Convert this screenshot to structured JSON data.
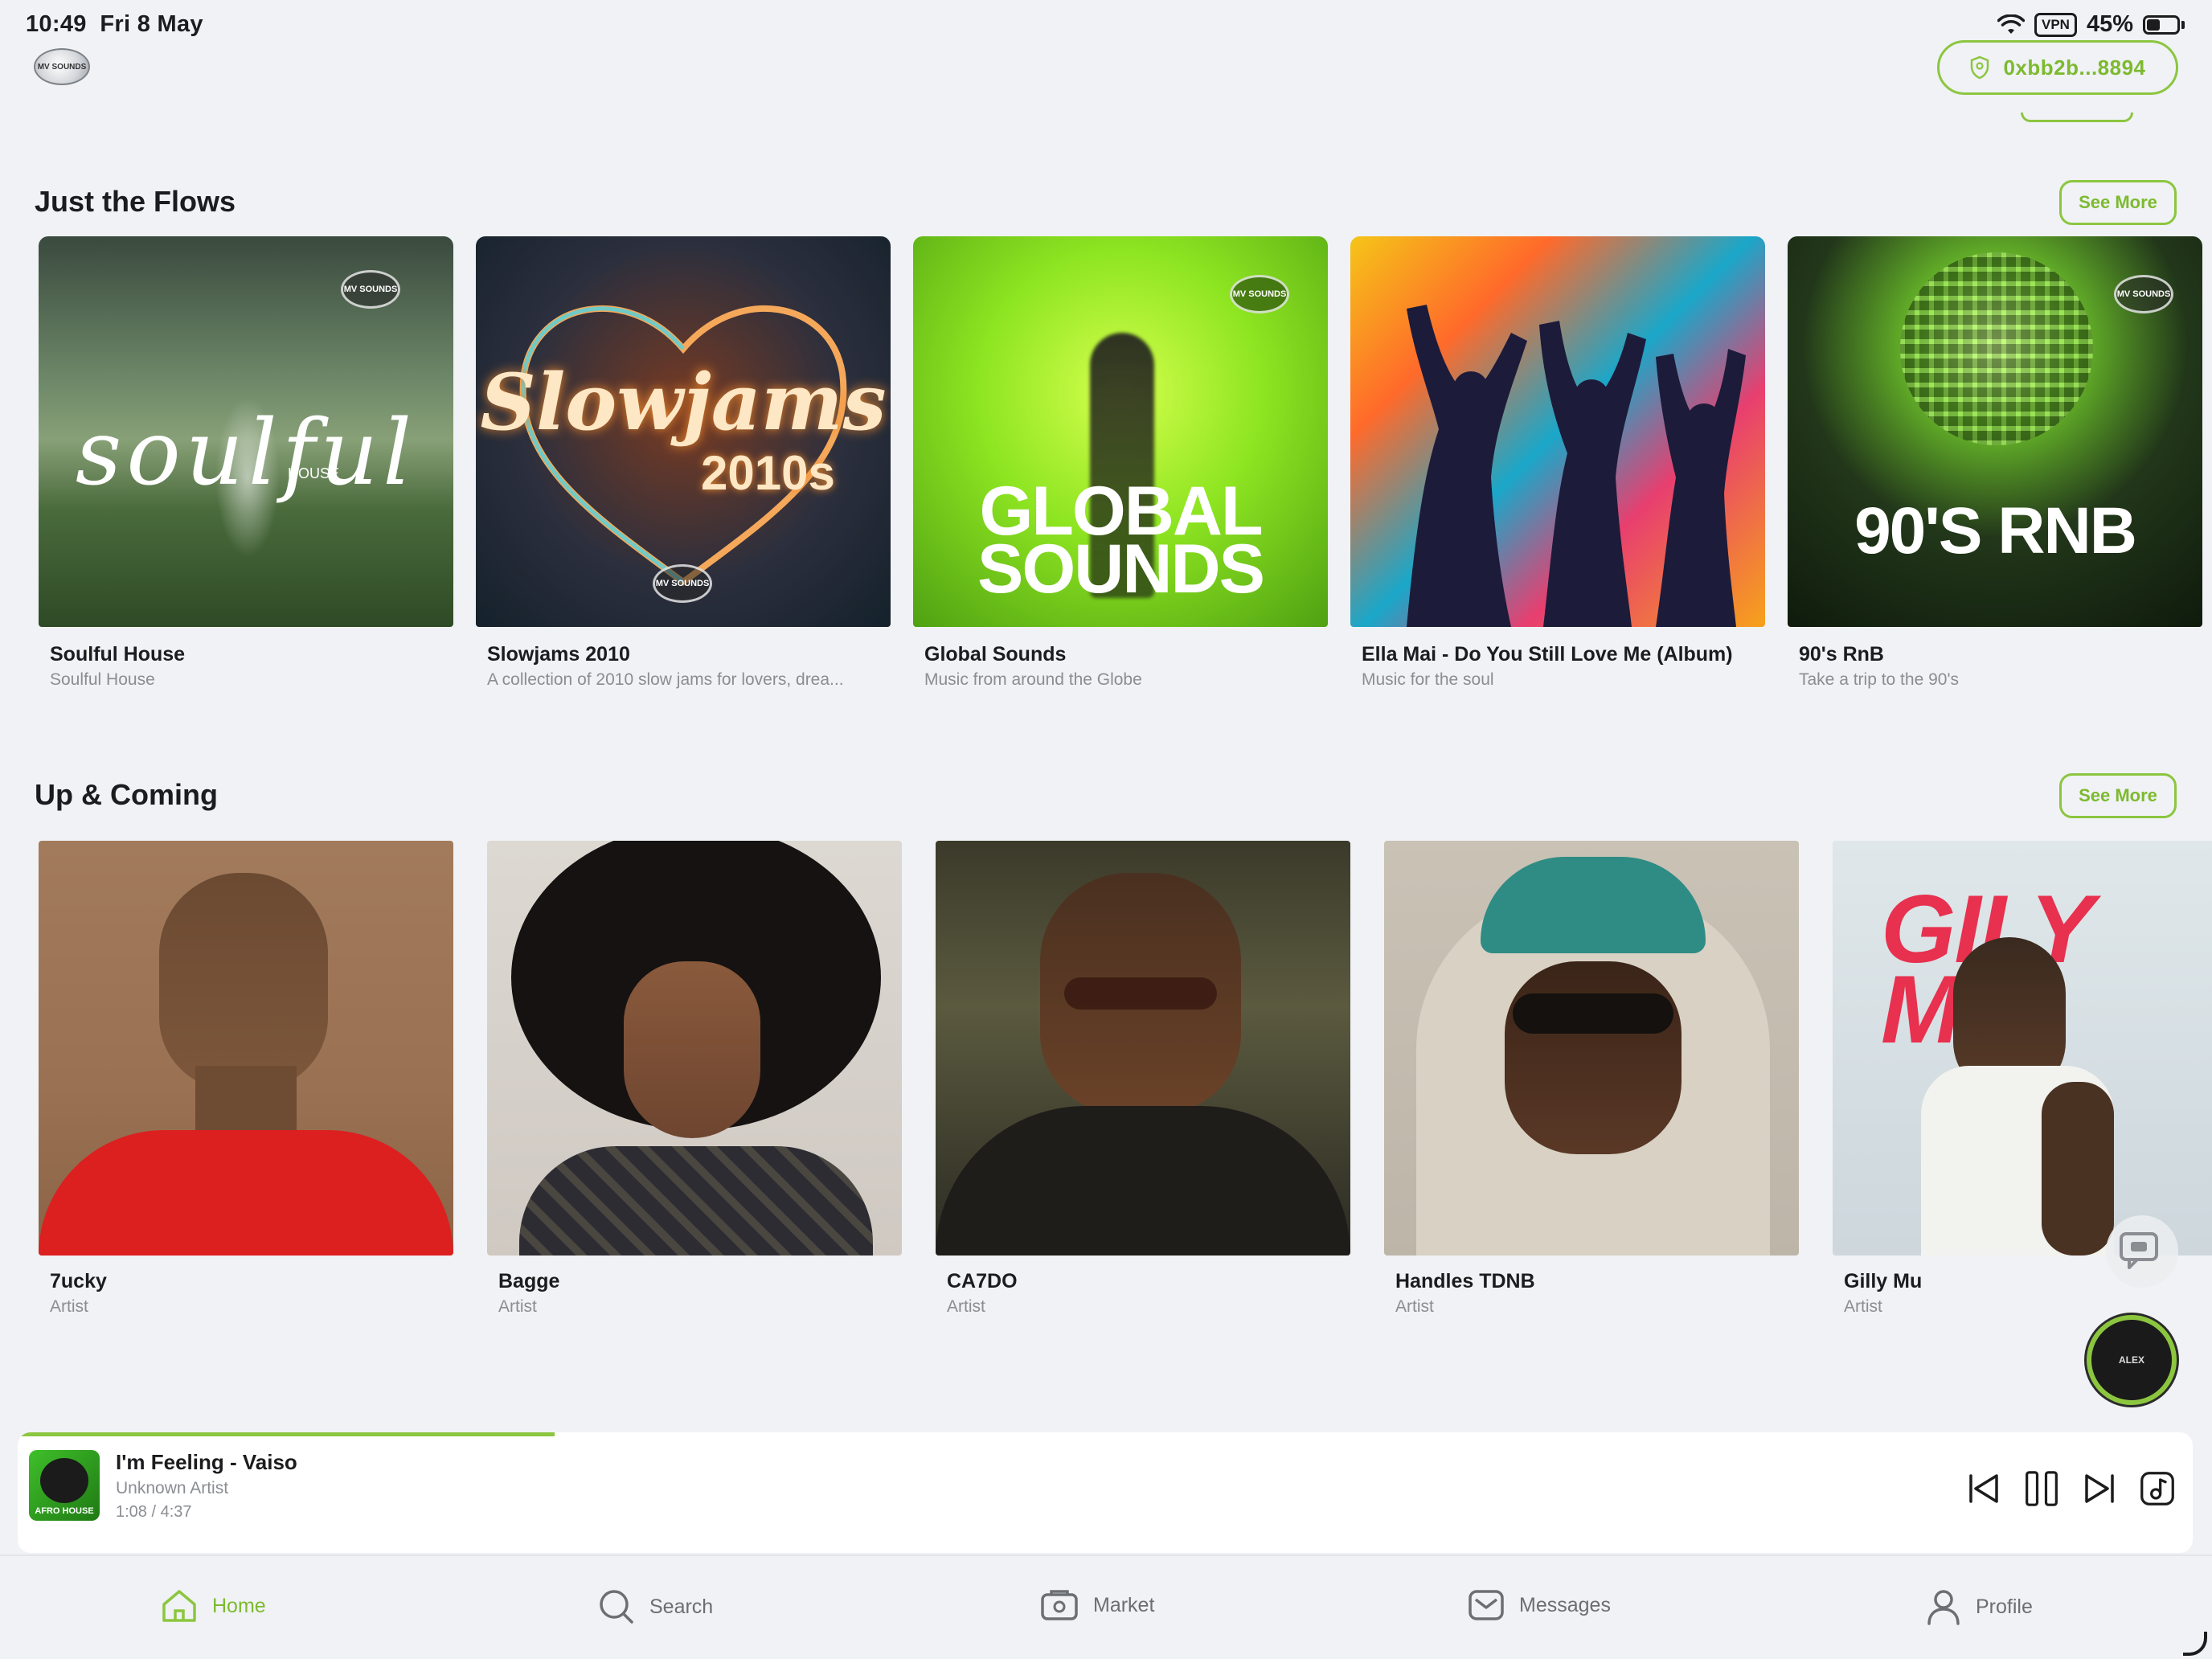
{
  "status_bar": {
    "time": "10:49",
    "date": "Fri 8 May",
    "vpn": "VPN",
    "battery": "45%"
  },
  "header": {
    "logo_text": "MV SOUNDS",
    "wallet_address": "0xbb2b...8894",
    "accent_color": "#8cc63f"
  },
  "flows": {
    "title": "Just the Flows",
    "see_more": "See More",
    "items": [
      {
        "title": "Soulful House",
        "subtitle": "Soulful House",
        "art_text": "soulful",
        "art_sub": "HOUSE",
        "badge": "MV SOUNDS"
      },
      {
        "title": "Slowjams 2010",
        "subtitle": "A collection of 2010 slow jams for lovers, drea...",
        "art_text": "Slowjams",
        "art_sub": "2010s",
        "badge": "MV SOUNDS"
      },
      {
        "title": "Global Sounds",
        "subtitle": "Music from around the Globe",
        "art_text": "GLOBAL",
        "art_sub": "SOUNDS",
        "badge": "MV SOUNDS"
      },
      {
        "title": "Ella Mai - Do You Still Love Me (Album)",
        "subtitle": "Music for the soul"
      },
      {
        "title": "90's RnB",
        "subtitle": "Take a trip to the 90's",
        "art_text": "90'S RNB",
        "badge": "MV SOUNDS"
      }
    ]
  },
  "upcoming": {
    "title": "Up & Coming",
    "see_more": "See More",
    "items": [
      {
        "name": "7ucky",
        "role": "Artist"
      },
      {
        "name": "Bagge",
        "role": "Artist"
      },
      {
        "name": "CA7DO",
        "role": "Artist"
      },
      {
        "name": "Handles TDNB",
        "role": "Artist"
      },
      {
        "name": "Gilly Mu",
        "role": "Artist",
        "art_text": "GILY MU"
      }
    ]
  },
  "floating": {
    "avatar_text": "ALEX"
  },
  "player": {
    "track": "I'm Feeling - Vaiso",
    "artist": "Unknown Artist",
    "time": "1:08 / 4:37",
    "progress": 0.247,
    "thumb_text": "AFRO HOUSE"
  },
  "tabs": [
    {
      "label": "Home",
      "icon": "home-icon",
      "active": true
    },
    {
      "label": "Search",
      "icon": "search-icon"
    },
    {
      "label": "Market",
      "icon": "market-icon"
    },
    {
      "label": "Messages",
      "icon": "messages-icon"
    },
    {
      "label": "Profile",
      "icon": "profile-icon"
    }
  ]
}
